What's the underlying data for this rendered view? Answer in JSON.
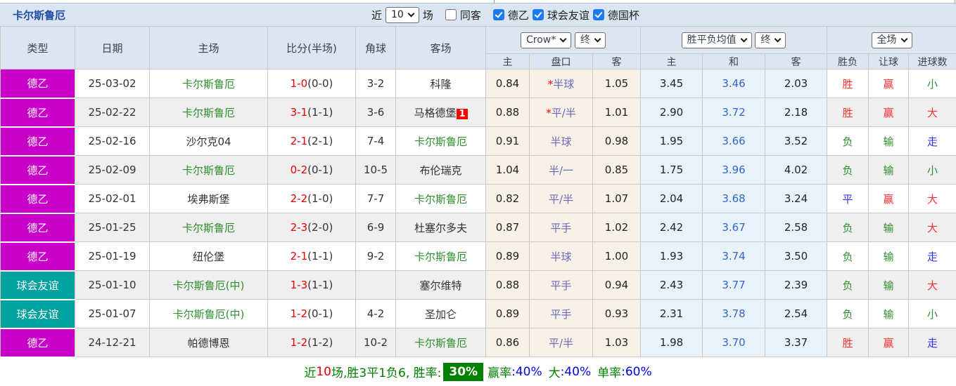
{
  "top": {
    "team": "卡尔斯鲁厄",
    "near_label": "近",
    "near_value": "10",
    "games_label": "场",
    "same_label": "同客",
    "same_checked": "",
    "filters": [
      {
        "label": "德乙",
        "cls": "checked"
      },
      {
        "label": "球会友谊",
        "cls": "checked"
      },
      {
        "label": "德国杯",
        "cls": "checked"
      }
    ]
  },
  "header": {
    "left_cols": [
      "类型",
      "日期",
      "主场",
      "比分(半场)",
      "角球",
      "客场"
    ],
    "crow_select": "Crow*",
    "crow_time": "终",
    "avg_select": "胜平负均值",
    "avg_time": "终",
    "scope_select": "全场",
    "sub_cols": [
      "主",
      "盘口",
      "客",
      "主",
      "和",
      "客",
      "胜负",
      "让球",
      "进球数"
    ]
  },
  "rows": [
    {
      "type": "德乙",
      "type_cls": "ty-league",
      "date": "25-03-02",
      "home": "卡尔斯鲁厄",
      "home_cls": "focus",
      "ft": "1-0",
      "ht": "(0-0)",
      "corner": "3-2",
      "away": "科隆",
      "away_cls": "opp",
      "away_badge": "",
      "star": "*",
      "handicap": "半球",
      "crow_home": "0.84",
      "crow_away": "1.05",
      "avg_home": "3.45",
      "avg_draw": "3.46",
      "avg_away": "2.03",
      "r_wdl": "胜",
      "r_wdl_cls": "t-red",
      "r_let": "赢",
      "r_let_cls": "t-red",
      "r_goal": "小",
      "r_goal_cls": "t-green"
    },
    {
      "type": "德乙",
      "type_cls": "ty-league",
      "date": "25-02-22",
      "home": "卡尔斯鲁厄",
      "home_cls": "focus",
      "ft": "3-1",
      "ht": "(1-1)",
      "corner": "3-6",
      "away": "马格德堡",
      "away_cls": "opp",
      "away_badge": "1",
      "star": "*",
      "handicap": "平/半",
      "crow_home": "0.88",
      "crow_away": "1.01",
      "avg_home": "2.90",
      "avg_draw": "3.72",
      "avg_away": "2.18",
      "r_wdl": "胜",
      "r_wdl_cls": "t-red",
      "r_let": "赢",
      "r_let_cls": "t-red",
      "r_goal": "大",
      "r_goal_cls": "t-red"
    },
    {
      "type": "德乙",
      "type_cls": "ty-league",
      "date": "25-02-16",
      "home": "沙尔克04",
      "home_cls": "opp",
      "ft": "2-1",
      "ht": "(2-1)",
      "corner": "7-4",
      "away": "卡尔斯鲁厄",
      "away_cls": "focus",
      "away_badge": "",
      "star": "",
      "handicap": "半球",
      "crow_home": "0.91",
      "crow_away": "0.98",
      "avg_home": "1.95",
      "avg_draw": "3.66",
      "avg_away": "3.52",
      "r_wdl": "负",
      "r_wdl_cls": "t-green",
      "r_let": "输",
      "r_let_cls": "t-green",
      "r_goal": "走",
      "r_goal_cls": "t-blue"
    },
    {
      "type": "德乙",
      "type_cls": "ty-league",
      "date": "25-02-09",
      "home": "卡尔斯鲁厄",
      "home_cls": "focus",
      "ft": "0-2",
      "ht": "(0-1)",
      "corner": "10-5",
      "away": "布伦瑞克",
      "away_cls": "opp",
      "away_badge": "",
      "star": "",
      "handicap": "半/一",
      "crow_home": "1.04",
      "crow_away": "0.85",
      "avg_home": "1.75",
      "avg_draw": "3.96",
      "avg_away": "4.02",
      "r_wdl": "负",
      "r_wdl_cls": "t-green",
      "r_let": "输",
      "r_let_cls": "t-green",
      "r_goal": "小",
      "r_goal_cls": "t-green"
    },
    {
      "type": "德乙",
      "type_cls": "ty-league",
      "date": "25-02-01",
      "home": "埃弗斯堡",
      "home_cls": "opp",
      "ft": "2-2",
      "ht": "(1-0)",
      "corner": "7-7",
      "away": "卡尔斯鲁厄",
      "away_cls": "focus",
      "away_badge": "",
      "star": "",
      "handicap": "平/半",
      "crow_home": "0.82",
      "crow_away": "1.07",
      "avg_home": "2.04",
      "avg_draw": "3.68",
      "avg_away": "3.24",
      "r_wdl": "平",
      "r_wdl_cls": "t-blue",
      "r_let": "赢",
      "r_let_cls": "t-red",
      "r_goal": "大",
      "r_goal_cls": "t-red"
    },
    {
      "type": "德乙",
      "type_cls": "ty-league",
      "date": "25-01-25",
      "home": "卡尔斯鲁厄",
      "home_cls": "focus",
      "ft": "2-3",
      "ht": "(2-0)",
      "corner": "6-9",
      "away": "杜塞尔多夫",
      "away_cls": "opp",
      "away_badge": "",
      "star": "",
      "handicap": "平手",
      "crow_home": "0.87",
      "crow_away": "1.02",
      "avg_home": "2.42",
      "avg_draw": "3.67",
      "avg_away": "2.58",
      "r_wdl": "负",
      "r_wdl_cls": "t-green",
      "r_let": "输",
      "r_let_cls": "t-green",
      "r_goal": "大",
      "r_goal_cls": "t-red"
    },
    {
      "type": "德乙",
      "type_cls": "ty-league",
      "date": "25-01-19",
      "home": "纽伦堡",
      "home_cls": "opp",
      "ft": "2-1",
      "ht": "(1-1)",
      "corner": "9-2",
      "away": "卡尔斯鲁厄",
      "away_cls": "focus",
      "away_badge": "",
      "star": "",
      "handicap": "半球",
      "crow_home": "0.89",
      "crow_away": "1.00",
      "avg_home": "1.93",
      "avg_draw": "3.74",
      "avg_away": "3.50",
      "r_wdl": "负",
      "r_wdl_cls": "t-green",
      "r_let": "输",
      "r_let_cls": "t-green",
      "r_goal": "走",
      "r_goal_cls": "t-blue"
    },
    {
      "type": "球会友谊",
      "type_cls": "ty-friendly",
      "date": "25-01-10",
      "home": "卡尔斯鲁厄(中)",
      "home_cls": "focus",
      "ft": "1-3",
      "ht": "(1-1)",
      "corner": "",
      "away": "塞尔维特",
      "away_cls": "opp",
      "away_badge": "",
      "star": "",
      "handicap": "平手",
      "crow_home": "0.88",
      "crow_away": "0.94",
      "avg_home": "2.43",
      "avg_draw": "3.77",
      "avg_away": "2.39",
      "r_wdl": "负",
      "r_wdl_cls": "t-green",
      "r_let": "输",
      "r_let_cls": "t-green",
      "r_goal": "大",
      "r_goal_cls": "t-red"
    },
    {
      "type": "球会友谊",
      "type_cls": "ty-friendly",
      "date": "25-01-07",
      "home": "卡尔斯鲁厄(中)",
      "home_cls": "focus",
      "ft": "1-2",
      "ht": "(0-1)",
      "corner": "4-2",
      "away": "圣加仑",
      "away_cls": "opp",
      "away_badge": "",
      "star": "",
      "handicap": "平手",
      "crow_home": "0.89",
      "crow_away": "0.93",
      "avg_home": "2.31",
      "avg_draw": "3.78",
      "avg_away": "2.54",
      "r_wdl": "负",
      "r_wdl_cls": "t-green",
      "r_let": "输",
      "r_let_cls": "t-green",
      "r_goal": "小",
      "r_goal_cls": "t-green"
    },
    {
      "type": "德乙",
      "type_cls": "ty-league",
      "date": "24-12-21",
      "home": "帕德博恩",
      "home_cls": "opp",
      "ft": "1-2",
      "ht": "(1-2)",
      "corner": "10-2",
      "away": "卡尔斯鲁厄",
      "away_cls": "focus",
      "away_badge": "",
      "star": "",
      "handicap": "平/半",
      "crow_home": "0.86",
      "crow_away": "1.03",
      "avg_home": "1.98",
      "avg_draw": "3.70",
      "avg_away": "3.37",
      "r_wdl": "胜",
      "r_wdl_cls": "t-red",
      "r_let": "赢",
      "r_let_cls": "t-red",
      "r_goal": "走",
      "r_goal_cls": "t-blue"
    }
  ],
  "footer": {
    "near_label": "近",
    "near_num": "10",
    "summary": "场,胜3平1负6, 胜率:",
    "win_rate": "30%",
    "win_label": "赢率",
    "win_pct": ":40%",
    "big_label": "大",
    "big_pct": ":40%",
    "single_label": "单率",
    "single_pct": ":60%"
  },
  "colors": {
    "header_bg": "#dbe5f1",
    "league_badge": "#c800c8",
    "friendly_badge": "#00a2a0",
    "focus_team_green": "#2f8f2f",
    "score_red": "#e60000",
    "crow_col_bg": "#f8f1e8",
    "avg_col_bg": "#e9f2f9",
    "avg_draw_blue": "#3366cc",
    "win_red": "#ff3030",
    "lose_green": "#2f8f2f",
    "push_blue": "#3333ff",
    "rate_badge_bg": "#008000"
  }
}
